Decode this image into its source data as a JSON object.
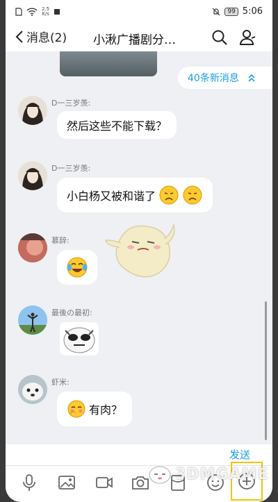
{
  "status_bar": {
    "speed_value": "2.5",
    "speed_unit": "K/s",
    "battery": "99",
    "time": "5:06"
  },
  "header": {
    "back_label": "消息(2)",
    "title": "小湫广播剧分…"
  },
  "new_messages": {
    "label": "40条新消息"
  },
  "messages": [
    {
      "sender": "D一三岁羡:",
      "text": "然后这些不能下载？"
    },
    {
      "sender": "D一三岁羡:",
      "text": "小白杨又被和谐了"
    },
    {
      "sender": "慕辞:",
      "text": ""
    },
    {
      "sender": "最後の最初:",
      "text": ""
    },
    {
      "sender": "虾米:",
      "text": "有肉？"
    }
  ],
  "input": {
    "send_label": "发送"
  },
  "watermark": {
    "text": "3DMGAME"
  },
  "colors": {
    "accent": "#1a9fe0",
    "bubble": "#ffffff",
    "background": "#eef0f3"
  }
}
